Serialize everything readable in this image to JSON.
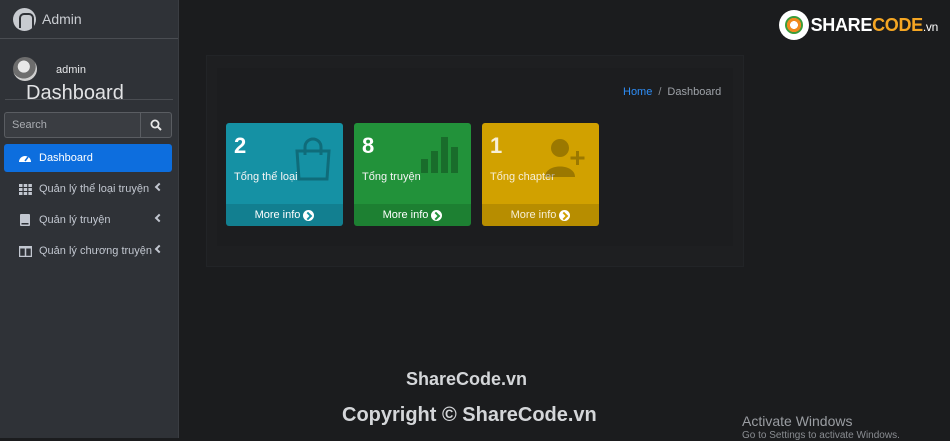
{
  "brand": {
    "name": "Admin"
  },
  "user": {
    "name": "admin"
  },
  "search": {
    "placeholder": "Search"
  },
  "menu": [
    {
      "label": "Dashboard",
      "icon": "dashboard-icon",
      "active": true
    },
    {
      "label": "Quản lý thể loại truyện",
      "icon": "grid-icon"
    },
    {
      "label": "Quản lý truyện",
      "icon": "book-icon"
    },
    {
      "label": "Quản lý chương truyện",
      "icon": "columns-icon"
    }
  ],
  "header": {
    "title": "Dashboard",
    "breadcrumb": {
      "home": "Home",
      "separator": "/",
      "current": "Dashboard"
    }
  },
  "stats": [
    {
      "value": "2",
      "label": "Tổng thể loại",
      "link": "More info",
      "color": "#1591a4",
      "icon": "shopping-bag-icon"
    },
    {
      "value": "8",
      "label": "Tổng truyện",
      "link": "More info",
      "color": "#22923a",
      "icon": "bar-chart-icon"
    },
    {
      "value": "1",
      "label": "Tổng chapter",
      "link": "More info",
      "color": "#d1a100",
      "icon": "user-plus-icon"
    }
  ],
  "watermark": {
    "logo_share": "SHARE",
    "logo_code": "CODE",
    "logo_vn": ".vn",
    "line1": "ShareCode.vn",
    "line2": "Copyright © ShareCode.vn"
  },
  "os_notice": {
    "title": "Activate Windows",
    "subtitle": "Go to Settings to activate Windows."
  },
  "colors": {
    "sidebar": "#2f3237",
    "accent": "#0d6ede",
    "link": "#2e8ef7"
  }
}
